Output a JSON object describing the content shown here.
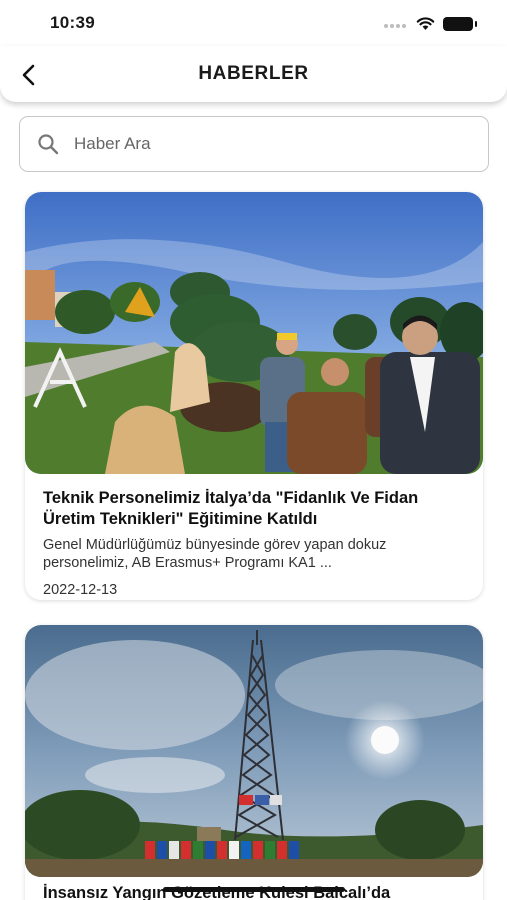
{
  "status_bar": {
    "time": "10:39"
  },
  "header": {
    "title": "HABERLER",
    "back_icon": "chevron-left-icon"
  },
  "search": {
    "placeholder": "Haber Ara",
    "value": ""
  },
  "news": [
    {
      "title": "Teknik Personelimiz İtalya’da \"Fidanlık Ve Fidan Üretim Teknikleri\" Eğitimine Katıldı",
      "summary": "Genel Müdürlüğümüz bünyesinde görev yapan dokuz personelimiz, AB Erasmus+ Programı KA1 ...",
      "date": "2022-12-13"
    },
    {
      "title": "İnsansız Yangın Gözetleme Kulesi Balcalı’da"
    }
  ],
  "colors": {
    "accent": "#111111",
    "border": "#c7c7c7"
  }
}
